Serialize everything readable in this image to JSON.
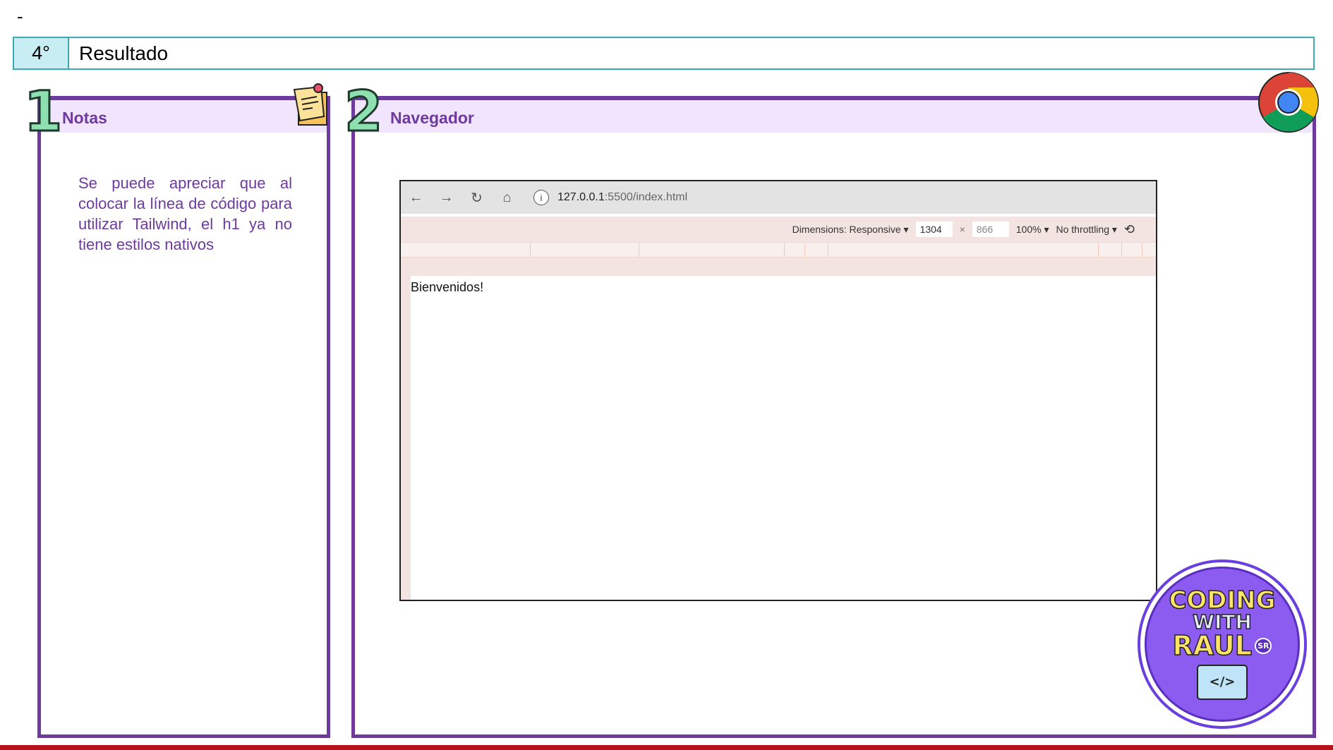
{
  "page_marker": "-",
  "header": {
    "step": "4°",
    "title": "Resultado"
  },
  "panel_notes": {
    "number": "1",
    "title": "Notas",
    "icon": "sticky-note-icon",
    "text": "Se puede apreciar que al colocar la línea de código para utilizar Tailwind, el h1 ya no tiene estilos nativos"
  },
  "panel_browser": {
    "number": "2",
    "title": "Navegador",
    "icon": "chrome-icon",
    "browser": {
      "url_host": "127.0.0.1",
      "url_rest": ":5500/index.html",
      "devtools": {
        "dimensions_label": "Dimensions: Responsive ▾",
        "width": "1304",
        "x": "×",
        "height": "866",
        "zoom": "100% ▾",
        "throttling": "No throttling ▾"
      },
      "page_text": "Bienvenidos!"
    }
  },
  "logo": {
    "line1": "CODING",
    "line2": "WITH",
    "line3": "RAUL",
    "badge": "SR"
  },
  "colors": {
    "accent": "#6e3a9e",
    "band": "#f1e4fd",
    "header_border": "#3fa9b0",
    "bottom_bar": "#b5121b"
  }
}
